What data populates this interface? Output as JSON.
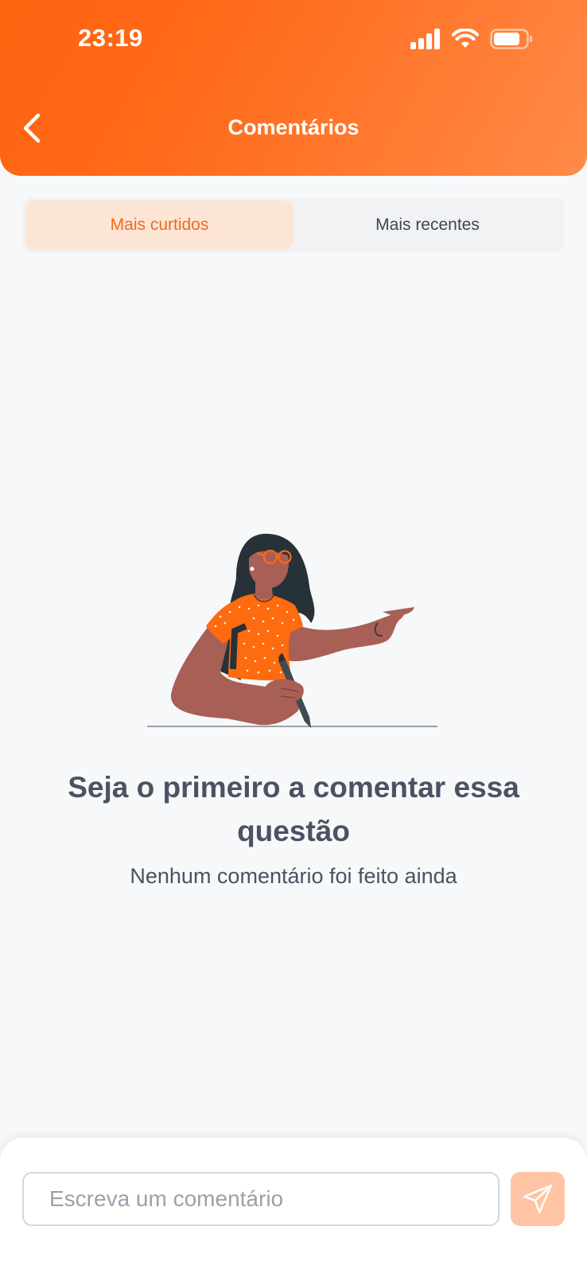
{
  "status_bar": {
    "time": "23:19"
  },
  "header": {
    "title": "Comentários",
    "back_icon": "chevron-left-icon"
  },
  "tabs": [
    {
      "label": "Mais curtidos",
      "active": true
    },
    {
      "label": "Mais recentes",
      "active": false
    }
  ],
  "empty_state": {
    "title": "Seja o primeiro a comentar essa questão",
    "subtitle": "Nenhum comentário foi feito ainda",
    "illustration": "woman-pointing-illustration"
  },
  "composer": {
    "placeholder": "Escreva um comentário",
    "value": "",
    "send_icon": "paper-plane-icon"
  },
  "colors": {
    "accent": "#ff6410",
    "accent_light": "#fde5d6",
    "send_disabled": "#ffc4a4",
    "text": "#4a5263"
  }
}
